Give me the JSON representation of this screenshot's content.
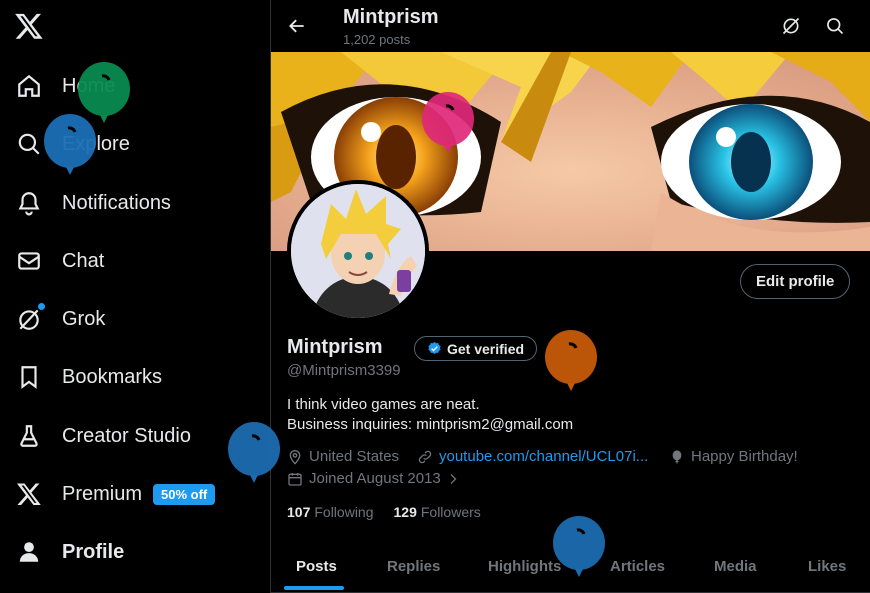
{
  "sidebar": {
    "items": [
      {
        "label": "Home",
        "icon": "home-icon"
      },
      {
        "label": "Explore",
        "icon": "search-icon"
      },
      {
        "label": "Notifications",
        "icon": "bell-icon"
      },
      {
        "label": "Chat",
        "icon": "mail-icon"
      },
      {
        "label": "Grok",
        "icon": "grok-icon"
      },
      {
        "label": "Bookmarks",
        "icon": "bookmark-icon"
      },
      {
        "label": "Creator Studio",
        "icon": "flask-icon"
      },
      {
        "label": "Premium",
        "icon": "x-logo-icon",
        "badge": "50% off"
      },
      {
        "label": "Profile",
        "icon": "person-icon"
      }
    ]
  },
  "topbar": {
    "title": "Mintprism",
    "subtitle": "1,202 posts"
  },
  "profile": {
    "edit_label": "Edit profile",
    "name": "Mintprism",
    "verified_label": "Get verified",
    "handle": "@Mintprism3399",
    "bio_line1": "I think video games are neat.",
    "bio_line2": "Business inquiries: mintprism2@gmail.com",
    "location": "United States",
    "website": "youtube.com/channel/UCL07i...",
    "birthday": "Happy Birthday!",
    "joined": "Joined August 2013",
    "following_count": "107",
    "following_label": "Following",
    "followers_count": "129",
    "followers_label": "Followers"
  },
  "tabs": [
    "Posts",
    "Replies",
    "Highlights",
    "Articles",
    "Media",
    "Likes"
  ],
  "colors": {
    "accent": "#1d9bf0",
    "background": "#000000",
    "muted": "#71767b",
    "balloons": [
      "#0a8a50",
      "#1a6fb5",
      "#e0287a",
      "#c55a08",
      "#1b6cb0"
    ]
  }
}
